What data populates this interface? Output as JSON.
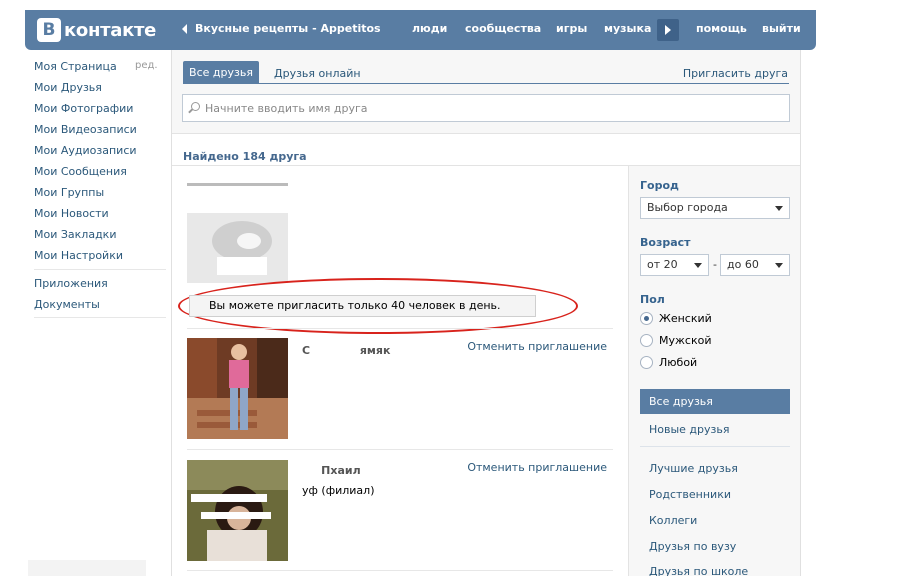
{
  "header": {
    "logo_letter": "В",
    "logo_text": "контакте",
    "back_title": "Вкусные рецепты - Appetitos",
    "nav": [
      "люди",
      "сообщества",
      "игры",
      "музыка",
      "помощь",
      "выйти"
    ]
  },
  "sidebar": {
    "edit_label": "ред.",
    "items": [
      "Моя Страница",
      "Мои Друзья",
      "Мои Фотографии",
      "Мои Видеозаписи",
      "Мои Аудиозаписи",
      "Мои Сообщения",
      "Мои Группы",
      "Мои Новости",
      "Мои Закладки",
      "Мои Настройки"
    ],
    "extra": [
      "Приложения",
      "Документы"
    ]
  },
  "main": {
    "tab_all": "Все друзья",
    "tab_online": "Друзья онлайн",
    "invite": "Пригласить друга",
    "search_placeholder": "Начните вводить имя друга",
    "found": "Найдено 184 друга",
    "alert": "Вы можете пригласить только 40 человек в день.",
    "cancel": "Отменить приглашение",
    "friend2_sub": "уф   (филиал)"
  },
  "filter": {
    "city_label": "Город",
    "city_value": "Выбор города",
    "age_label": "Возраст",
    "age_from": "от 20",
    "age_to": "до 60",
    "gender_label": "Пол",
    "genders": [
      "Женский",
      "Мужской",
      "Любой"
    ],
    "categories": [
      "Все друзья",
      "Новые друзья",
      "Лучшие друзья",
      "Родственники",
      "Коллеги",
      "Друзья по вузу",
      "Друзья по школе"
    ]
  },
  "colors": {
    "header": "#597da3",
    "link": "#2b587a",
    "highlight": "#d8231c"
  }
}
